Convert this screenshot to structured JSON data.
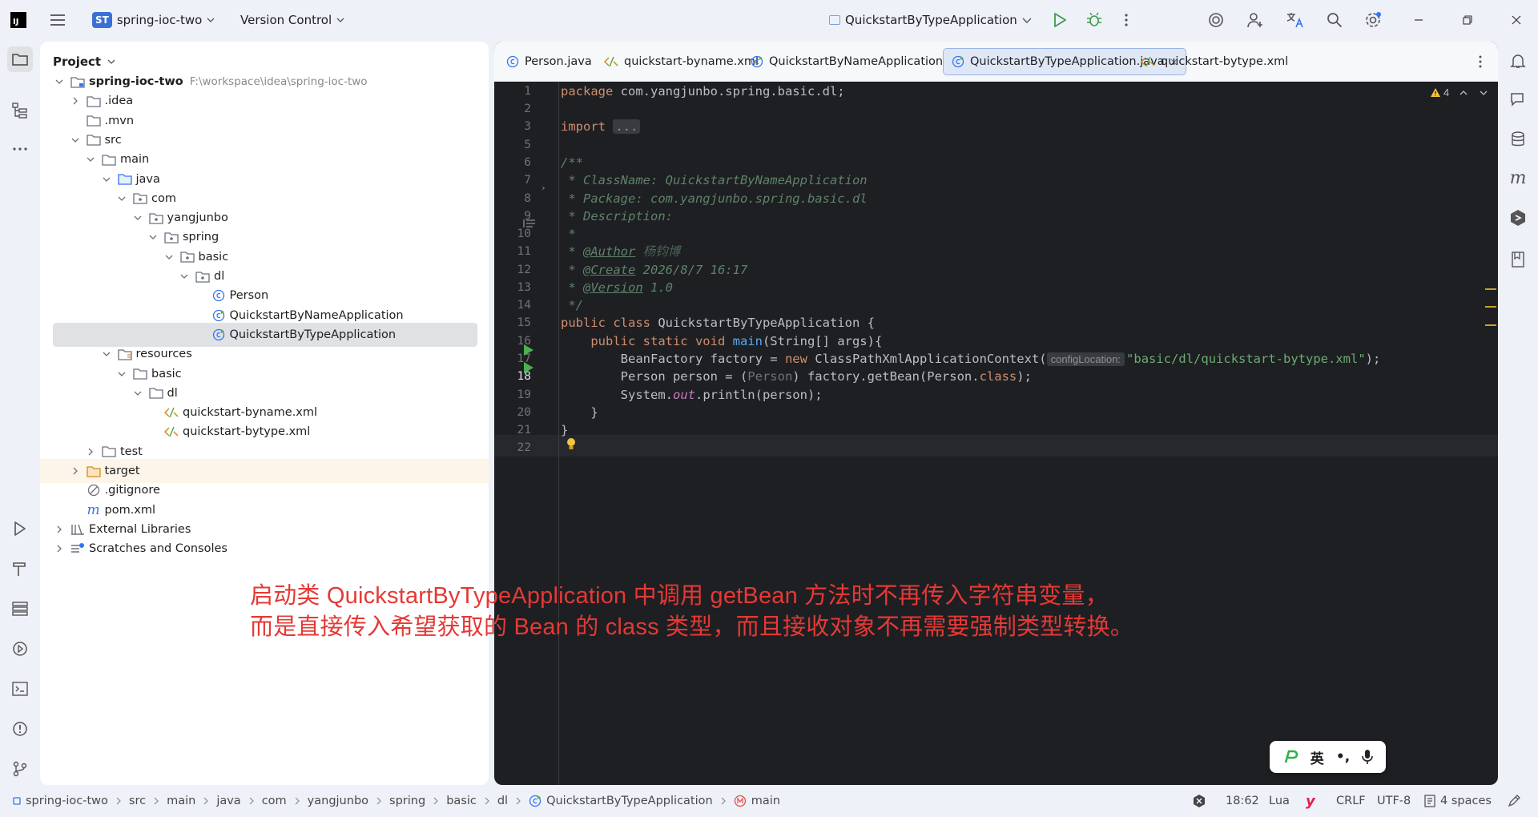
{
  "app": {
    "logo": "IJ",
    "project_badge": "ST",
    "project_name": "spring-ioc-two",
    "vcs_label": "Version Control",
    "run_config": "QuickstartByTypeApplication"
  },
  "project_panel": {
    "title": "Project",
    "tree": [
      {
        "label": "spring-ioc-two",
        "extra": "F:\\workspace\\idea\\spring-ioc-two",
        "depth": 0,
        "arrow": "down",
        "icon": "module-folder-icon",
        "bold": true
      },
      {
        "label": ".idea",
        "depth": 1,
        "arrow": "right",
        "icon": "folder-icon"
      },
      {
        "label": ".mvn",
        "depth": 1,
        "arrow": "",
        "icon": "folder-icon"
      },
      {
        "label": "src",
        "depth": 1,
        "arrow": "down",
        "icon": "folder-icon"
      },
      {
        "label": "main",
        "depth": 2,
        "arrow": "down",
        "icon": "folder-icon"
      },
      {
        "label": "java",
        "depth": 3,
        "arrow": "down",
        "icon": "source-folder-icon"
      },
      {
        "label": "com",
        "depth": 4,
        "arrow": "down",
        "icon": "package-icon"
      },
      {
        "label": "yangjunbo",
        "depth": 5,
        "arrow": "down",
        "icon": "package-icon"
      },
      {
        "label": "spring",
        "depth": 6,
        "arrow": "down",
        "icon": "package-icon"
      },
      {
        "label": "basic",
        "depth": 7,
        "arrow": "down",
        "icon": "package-icon"
      },
      {
        "label": "dl",
        "depth": 8,
        "arrow": "down",
        "icon": "package-icon"
      },
      {
        "label": "Person",
        "depth": 9,
        "arrow": "",
        "icon": "class-icon"
      },
      {
        "label": "QuickstartByNameApplication",
        "depth": 9,
        "arrow": "",
        "icon": "runnable-class-icon"
      },
      {
        "label": "QuickstartByTypeApplication",
        "depth": 9,
        "arrow": "",
        "icon": "runnable-class-icon",
        "selected": true
      },
      {
        "label": "resources",
        "depth": 3,
        "arrow": "down",
        "icon": "resources-folder-icon"
      },
      {
        "label": "basic",
        "depth": 4,
        "arrow": "down",
        "icon": "folder-icon"
      },
      {
        "label": "dl",
        "depth": 5,
        "arrow": "down",
        "icon": "folder-icon"
      },
      {
        "label": "quickstart-byname.xml",
        "depth": 6,
        "arrow": "",
        "icon": "xml-icon"
      },
      {
        "label": "quickstart-bytype.xml",
        "depth": 6,
        "arrow": "",
        "icon": "xml-icon"
      },
      {
        "label": "test",
        "depth": 2,
        "arrow": "right",
        "icon": "folder-icon"
      },
      {
        "label": "target",
        "depth": 1,
        "arrow": "right",
        "icon": "excluded-folder-icon",
        "highlight": true
      },
      {
        "label": ".gitignore",
        "depth": 1,
        "arrow": "",
        "icon": "ignore-file-icon"
      },
      {
        "label": "pom.xml",
        "depth": 1,
        "arrow": "",
        "icon": "maven-icon"
      },
      {
        "label": "External Libraries",
        "depth": 0,
        "arrow": "right",
        "icon": "library-icon"
      },
      {
        "label": "Scratches and Consoles",
        "depth": 0,
        "arrow": "right",
        "icon": "scratches-icon"
      }
    ]
  },
  "tabs": [
    {
      "label": "Person.java",
      "icon": "class-icon"
    },
    {
      "label": "quickstart-byname.xml",
      "icon": "xml-icon"
    },
    {
      "label": "QuickstartByNameApplication.java",
      "icon": "runnable-class-icon"
    },
    {
      "label": "QuickstartByTypeApplication.java",
      "icon": "runnable-class-icon",
      "active": true
    },
    {
      "label": "quickstart-bytype.xml",
      "icon": "xml-icon"
    }
  ],
  "editor": {
    "warning_count": "4",
    "line_numbers": [
      "1",
      "2",
      "3",
      "5",
      "6",
      "7",
      "8",
      "9",
      "10",
      "11",
      "12",
      "13",
      "14",
      "15",
      "16",
      "17",
      "18",
      "19",
      "20",
      "21",
      "22"
    ],
    "current_line": "18",
    "code": {
      "l1_kw": "package",
      "l1_rest": " com.yangjunbo.spring.basic.dl;",
      "l3_kw": "import",
      "l3_fold": "...",
      "l6": "/**",
      "l7": " * ClassName: QuickstartByNameApplication",
      "l8": " * Package: com.yangjunbo.spring.basic.dl",
      "l9": " * Description:",
      "l10": " *",
      "l11_a": " * ",
      "l11_tag": "@Author",
      "l11_b": " 杨钧博",
      "l12_a": " * ",
      "l12_tag": "@Create",
      "l12_b": " 2026/8/7 16:17",
      "l13_a": " * ",
      "l13_tag": "@Version",
      "l13_b": " 1.0",
      "l14": " */",
      "l15_kw": "public class",
      "l15_rest": " QuickstartByTypeApplication {",
      "l16_kw": "    public static void ",
      "l16_fn": "main",
      "l16_rest": "(String[] args){",
      "l17_a": "        BeanFactory factory = ",
      "l17_kw": "new",
      "l17_b": " ClassPathXmlApplicationContext(",
      "l17_hint": "configLocation:",
      "l17_str": "\"basic/dl/quickstart-bytype.xml\"",
      "l17_c": ");",
      "l18_a": "        Person person = (",
      "l18_cast": "Person",
      "l18_b": ") factory.getBean(Person.",
      "l18_kw": "class",
      "l18_c": ");",
      "l19_a": "        System.",
      "l19_fld": "out",
      "l19_b": ".println(person);",
      "l20": "    }",
      "l21": "}"
    }
  },
  "annotation": {
    "line1": "启动类 QuickstartByTypeApplication 中调用 getBean 方法时不再传入字符串变量，",
    "line2": "而是直接传入希望获取的 Bean 的 class 类型，而且接收对象不再需要强制类型转换。"
  },
  "ime": {
    "lang": "英",
    "punct": "•,"
  },
  "statusbar": {
    "breadcrumbs": [
      "spring-ioc-two",
      "src",
      "main",
      "java",
      "com",
      "yangjunbo",
      "spring",
      "basic",
      "dl",
      "QuickstartByTypeApplication",
      "main"
    ],
    "position": "18:62",
    "language": "Lua",
    "line_sep": "CRLF",
    "encoding": "UTF-8",
    "indent": "4 spaces"
  },
  "colors": {
    "accent": "#3574f0",
    "run_green": "#4caf50",
    "annotation_red": "#e53935",
    "editor_bg": "#1e1f22"
  }
}
